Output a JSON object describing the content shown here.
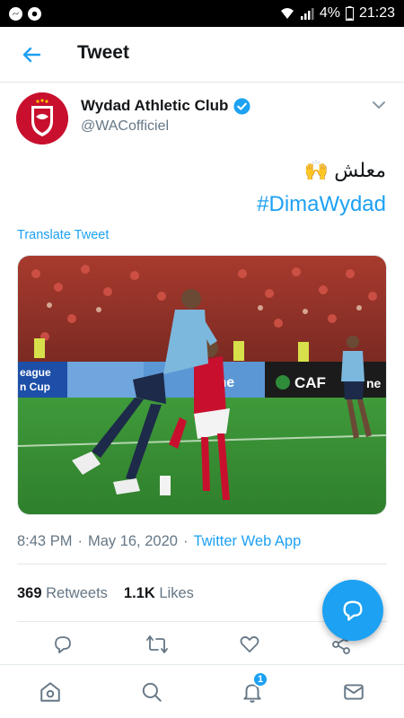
{
  "status_bar": {
    "battery": "4%",
    "time": "21:23"
  },
  "header": {
    "title": "Tweet"
  },
  "tweet": {
    "author_name": "Wydad Athletic Club",
    "author_handle": "@WACofficiel",
    "text_line1": "معلش",
    "emoji": "🙌",
    "hashtag": "#DimaWydad",
    "translate_label": "Translate Tweet",
    "time": "8:43 PM",
    "date": "May 16, 2020",
    "separator": "·",
    "source_app": "Twitter Web App",
    "retweets_count": "369",
    "retweets_label": "Retweets",
    "likes_count": "1.1K",
    "likes_label": "Likes"
  },
  "media": {
    "banner_left_1": "eague",
    "banner_left_2": "n Cup",
    "banner_middle": "me",
    "banner_right": "CAF",
    "banner_right_2": "ne"
  },
  "nav": {
    "notifications_badge": "1"
  },
  "colors": {
    "accent": "#1da1f2",
    "club_red": "#c8102e"
  }
}
